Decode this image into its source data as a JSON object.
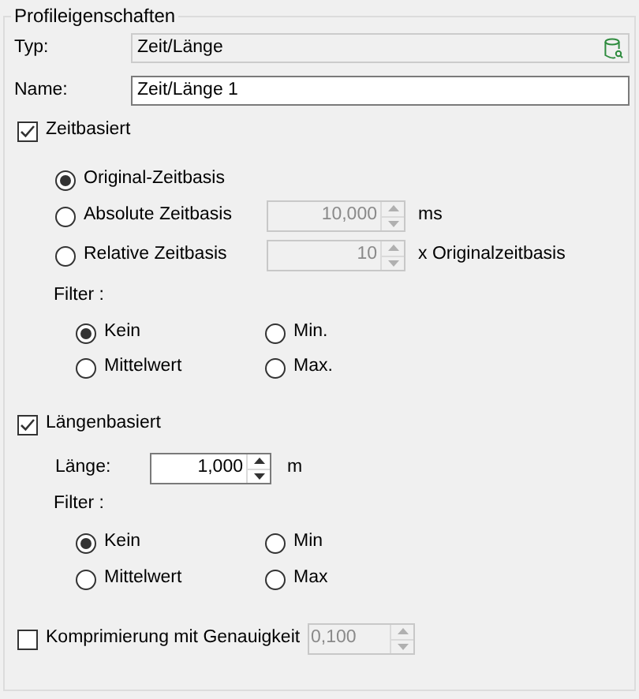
{
  "group": {
    "title": "Profileigenschaften"
  },
  "fields": [
    {
      "label": "Typ:",
      "value": "Zeit/Länge",
      "disabled": true
    },
    {
      "label": "Name:",
      "value": "Zeit/Länge 1",
      "disabled": false
    }
  ],
  "time_based": {
    "label": "Zeitbasiert",
    "checked": true,
    "modes": [
      {
        "label": "Original-Zeitbasis",
        "selected": true
      },
      {
        "label": "Absolute Zeitbasis",
        "selected": false,
        "value": "10,000",
        "unit": "ms"
      },
      {
        "label": "Relative Zeitbasis",
        "selected": false,
        "value": "10",
        "unit": "x Originalzeitbasis"
      }
    ],
    "filter": {
      "label": "Filter :",
      "options": [
        {
          "label": "Kein",
          "selected": true
        },
        {
          "label": "Min.",
          "selected": false
        },
        {
          "label": "Mittelwert",
          "selected": false
        },
        {
          "label": "Max.",
          "selected": false
        }
      ]
    }
  },
  "length_based": {
    "label": "Längenbasiert",
    "checked": true,
    "length": {
      "label": "Länge:",
      "value": "1,000",
      "unit": "m"
    },
    "filter": {
      "label": "Filter :",
      "options": [
        {
          "label": "Kein",
          "selected": true
        },
        {
          "label": "Min",
          "selected": false
        },
        {
          "label": "Mittelwert",
          "selected": false
        },
        {
          "label": "Max",
          "selected": false
        }
      ]
    }
  },
  "compression": {
    "label": "Komprimierung mit Genauigkeit",
    "checked": false,
    "value": "0,100"
  }
}
